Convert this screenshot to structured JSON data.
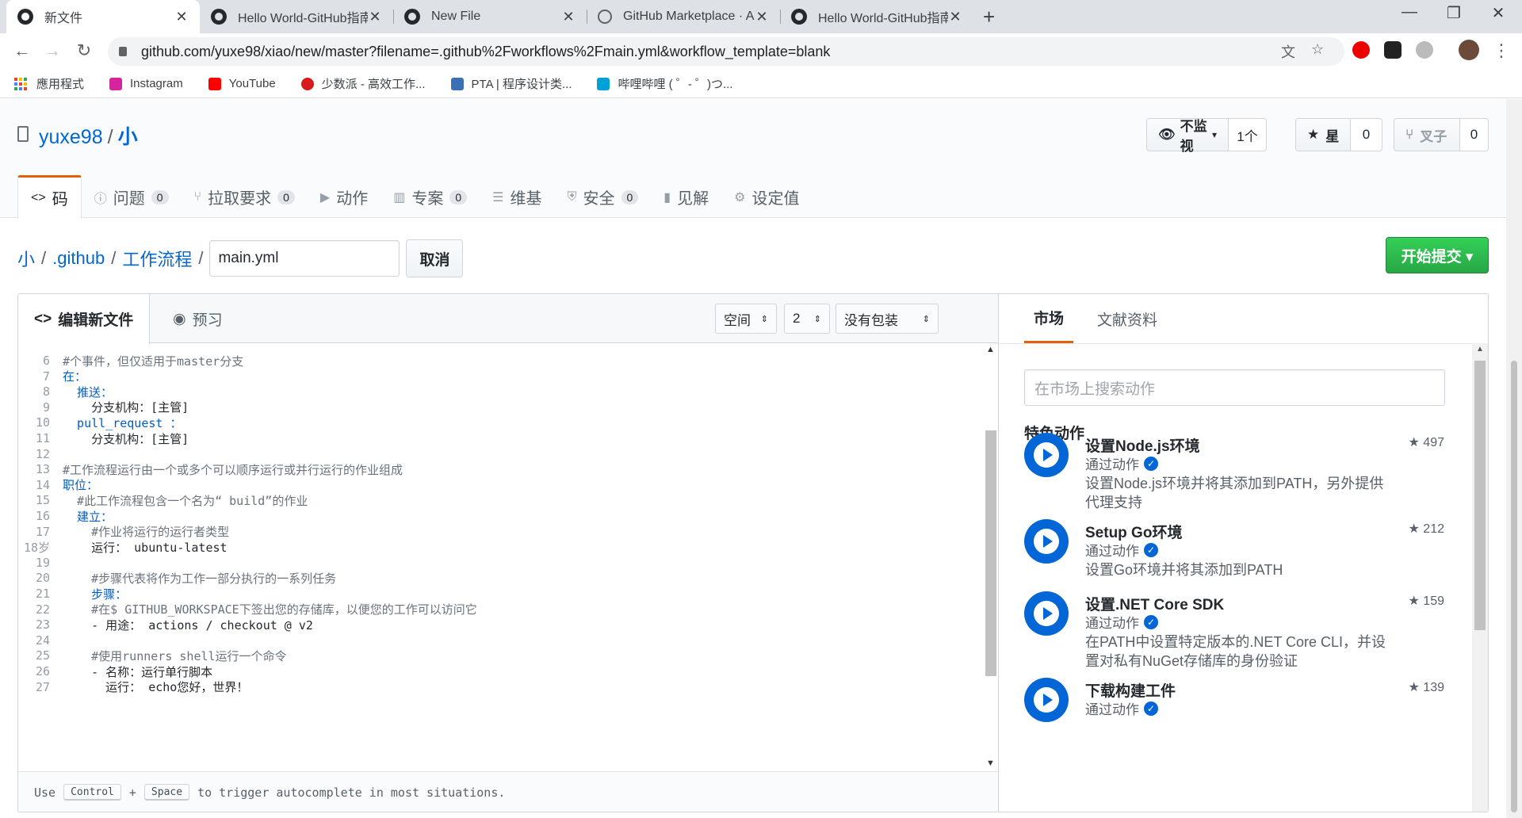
{
  "browser": {
    "tabs": [
      {
        "title": "新文件",
        "icon": "github-icon",
        "active": true
      },
      {
        "title": "Hello World-GitHub指南",
        "icon": "github-icon",
        "active": false
      },
      {
        "title": "New File",
        "icon": "github-icon",
        "active": false
      },
      {
        "title": "GitHub Marketplace · Actions t",
        "icon": "globe-icon",
        "active": false
      },
      {
        "title": "Hello World-GitHub指南",
        "icon": "github-icon",
        "active": false
      }
    ],
    "close_glyph": "✕",
    "new_tab_glyph": "+",
    "window_controls": [
      "—",
      "❐",
      "✕"
    ],
    "url": "github.com/yuxe98/xiao/new/master?filename=.github%2Fworkflows%2Fmain.yml&workflow_template=blank",
    "nav": {
      "back": "←",
      "forward": "→",
      "reload": "↻"
    },
    "bookmarks": [
      {
        "label": "應用程式",
        "icon": "apps-grid-icon"
      },
      {
        "label": "Instagram",
        "icon": "instagram-icon",
        "color": "#d6249f"
      },
      {
        "label": "YouTube",
        "icon": "youtube-icon",
        "color": "#ff0000"
      },
      {
        "label": "少数派 - 高效工作...",
        "icon": "sspai-icon",
        "color": "#d71a1b"
      },
      {
        "label": "PTA | 程序设计类...",
        "icon": "pta-icon",
        "color": "#3b6fb6"
      },
      {
        "label": "哔哩哔哩 ( ゜- ゜)つ...",
        "icon": "bilibili-icon",
        "color": "#00a1d6"
      }
    ]
  },
  "repo": {
    "owner": "yuxe98",
    "separator": "/",
    "name": "小",
    "watch_label": "不监视",
    "watch_count": "1个",
    "star_label": "星",
    "star_count": "0",
    "fork_label": "叉子",
    "fork_count": "0"
  },
  "repo_tabs": [
    {
      "icon": "<>",
      "label": "码",
      "count": null,
      "selected": true
    },
    {
      "icon": "ⓘ",
      "label": "问题",
      "count": "0"
    },
    {
      "icon": "⑂",
      "label": "拉取要求",
      "count": "0"
    },
    {
      "icon": "▶",
      "label": "动作",
      "count": null
    },
    {
      "icon": "▥",
      "label": "专案",
      "count": "0"
    },
    {
      "icon": "☰",
      "label": "维基",
      "count": null
    },
    {
      "icon": "⛨",
      "label": "安全",
      "count": "0"
    },
    {
      "icon": "▮",
      "label": "见解",
      "count": null
    },
    {
      "icon": "⚙",
      "label": "设定值",
      "count": null
    }
  ],
  "breadcrumb": {
    "root": "小",
    "dir1": ".github",
    "dir2": "工作流程",
    "sep": "/",
    "filename": "main.yml",
    "cancel": "取消"
  },
  "commit_button": "开始提交 ▾",
  "editor": {
    "tab_edit": "编辑新文件",
    "tab_preview": "预习",
    "indent_mode": "空间",
    "indent_size": "2",
    "wrap_mode": "没有包装",
    "lines": [
      {
        "n": "6",
        "text": "#个事件，但仅适用于master分支",
        "kind": "cm"
      },
      {
        "n": "7",
        "text": "在：",
        "kind": "key"
      },
      {
        "n": "8",
        "text": "  推送：",
        "kind": "key"
      },
      {
        "n": "9",
        "text": "    分支机构：[主管]",
        "kind": "mix"
      },
      {
        "n": "10",
        "text": "  pull_request ：",
        "kind": "key"
      },
      {
        "n": "11",
        "text": "    分支机构：[主管]",
        "kind": "mix"
      },
      {
        "n": "12",
        "text": "",
        "kind": "ct"
      },
      {
        "n": "13",
        "text": "#工作流程运行由一个或多个可以顺序运行或并行运行的作业组成",
        "kind": "cm"
      },
      {
        "n": "14",
        "text": "职位：",
        "kind": "key"
      },
      {
        "n": "15",
        "text": "  #此工作流程包含一个名为“ build”的作业",
        "kind": "cm"
      },
      {
        "n": "16",
        "text": "  建立：",
        "kind": "key"
      },
      {
        "n": "17",
        "text": "    #作业将运行的运行者类型",
        "kind": "cm"
      },
      {
        "n": "18岁",
        "text": "    运行： ubuntu-latest",
        "kind": "mix"
      },
      {
        "n": "19",
        "text": "",
        "kind": "ct"
      },
      {
        "n": "20",
        "text": "    #步骤代表将作为工作一部分执行的一系列任务",
        "kind": "cm"
      },
      {
        "n": "21",
        "text": "    步骤：",
        "kind": "key"
      },
      {
        "n": "22",
        "text": "    #在$ GITHUB_WORKSPACE下签出您的存储库，以便您的工作可以访问它",
        "kind": "cm"
      },
      {
        "n": "23",
        "text": "    - 用途： actions / checkout @ v2",
        "kind": "mix"
      },
      {
        "n": "24",
        "text": "",
        "kind": "ct"
      },
      {
        "n": "25",
        "text": "    #使用runners shell运行一个命令",
        "kind": "cm"
      },
      {
        "n": "26",
        "text": "    - 名称：运行单行脚本",
        "kind": "mix"
      },
      {
        "n": "27",
        "text": "      运行： echo您好，世界！",
        "kind": "mix"
      }
    ],
    "footer_use": "Use",
    "footer_key1": "Control",
    "footer_plus": "+",
    "footer_key2": "Space",
    "footer_rest": "to trigger autocomplete in most situations."
  },
  "marketplace": {
    "tab_market": "市场",
    "tab_docs": "文献资料",
    "search_placeholder": "在市场上搜索动作",
    "featured_title": "特色动作",
    "actions": [
      {
        "name": "设置Node.js环境",
        "by": "通过动作",
        "desc": "设置Node.js环境并将其添加到PATH，另外提供代理支持",
        "stars": "497"
      },
      {
        "name": "Setup Go环境",
        "by": "通过动作",
        "desc": "设置Go环境并将其添加到PATH",
        "stars": "212"
      },
      {
        "name": "设置.NET Core SDK",
        "by": "通过动作",
        "desc": "在PATH中设置特定版本的.NET Core CLI，并设置对私有NuGet存储库的身份验证",
        "stars": "159"
      },
      {
        "name": "下载构建工件",
        "by": "通过动作",
        "desc": "",
        "stars": "139"
      }
    ]
  }
}
